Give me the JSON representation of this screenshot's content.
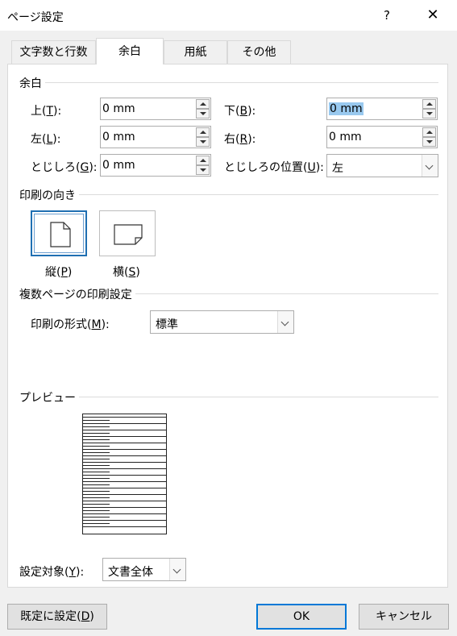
{
  "window": {
    "title": "ページ設定",
    "help_label": "?",
    "close_label": "✕"
  },
  "tabs": [
    {
      "label": "文字数と行数",
      "active": false
    },
    {
      "label": "余白",
      "active": true
    },
    {
      "label": "用紙",
      "active": false
    },
    {
      "label": "その他",
      "active": false
    }
  ],
  "margins": {
    "section": "余白",
    "top": {
      "label": "上(",
      "key": "T",
      "tail": "):",
      "value": "0 mm"
    },
    "bottom": {
      "label": "下(",
      "key": "B",
      "tail": "):",
      "value": "0 mm"
    },
    "left": {
      "label": "左(",
      "key": "L",
      "tail": "):",
      "value": "0 mm"
    },
    "right": {
      "label": "右(",
      "key": "R",
      "tail": "):",
      "value": "0 mm"
    },
    "gutter": {
      "label": "とじしろ(",
      "key": "G",
      "tail": "):",
      "value": "0 mm"
    },
    "gutter_pos": {
      "label": "とじしろの位置(",
      "key": "U",
      "tail": "):",
      "value": "左"
    }
  },
  "orientation": {
    "section": "印刷の向き",
    "portrait": {
      "label": "縦(",
      "key": "P",
      "tail": ")",
      "selected": true
    },
    "landscape": {
      "label": "横(",
      "key": "S",
      "tail": ")",
      "selected": false
    }
  },
  "multiple_pages": {
    "section": "複数ページの印刷設定",
    "format_label": "印刷の形式(",
    "format_key": "M",
    "format_tail": "):",
    "format_value": "標準"
  },
  "preview": {
    "section": "プレビュー"
  },
  "apply_to": {
    "label": "設定対象(",
    "key": "Y",
    "tail": "):",
    "value": "文書全体"
  },
  "buttons": {
    "set_default": {
      "label": "既定に設定(",
      "key": "D",
      "tail": ")"
    },
    "ok": "OK",
    "cancel": "キャンセル"
  },
  "colors": {
    "accent": "#0078d7",
    "selection": "#99c9ef"
  }
}
